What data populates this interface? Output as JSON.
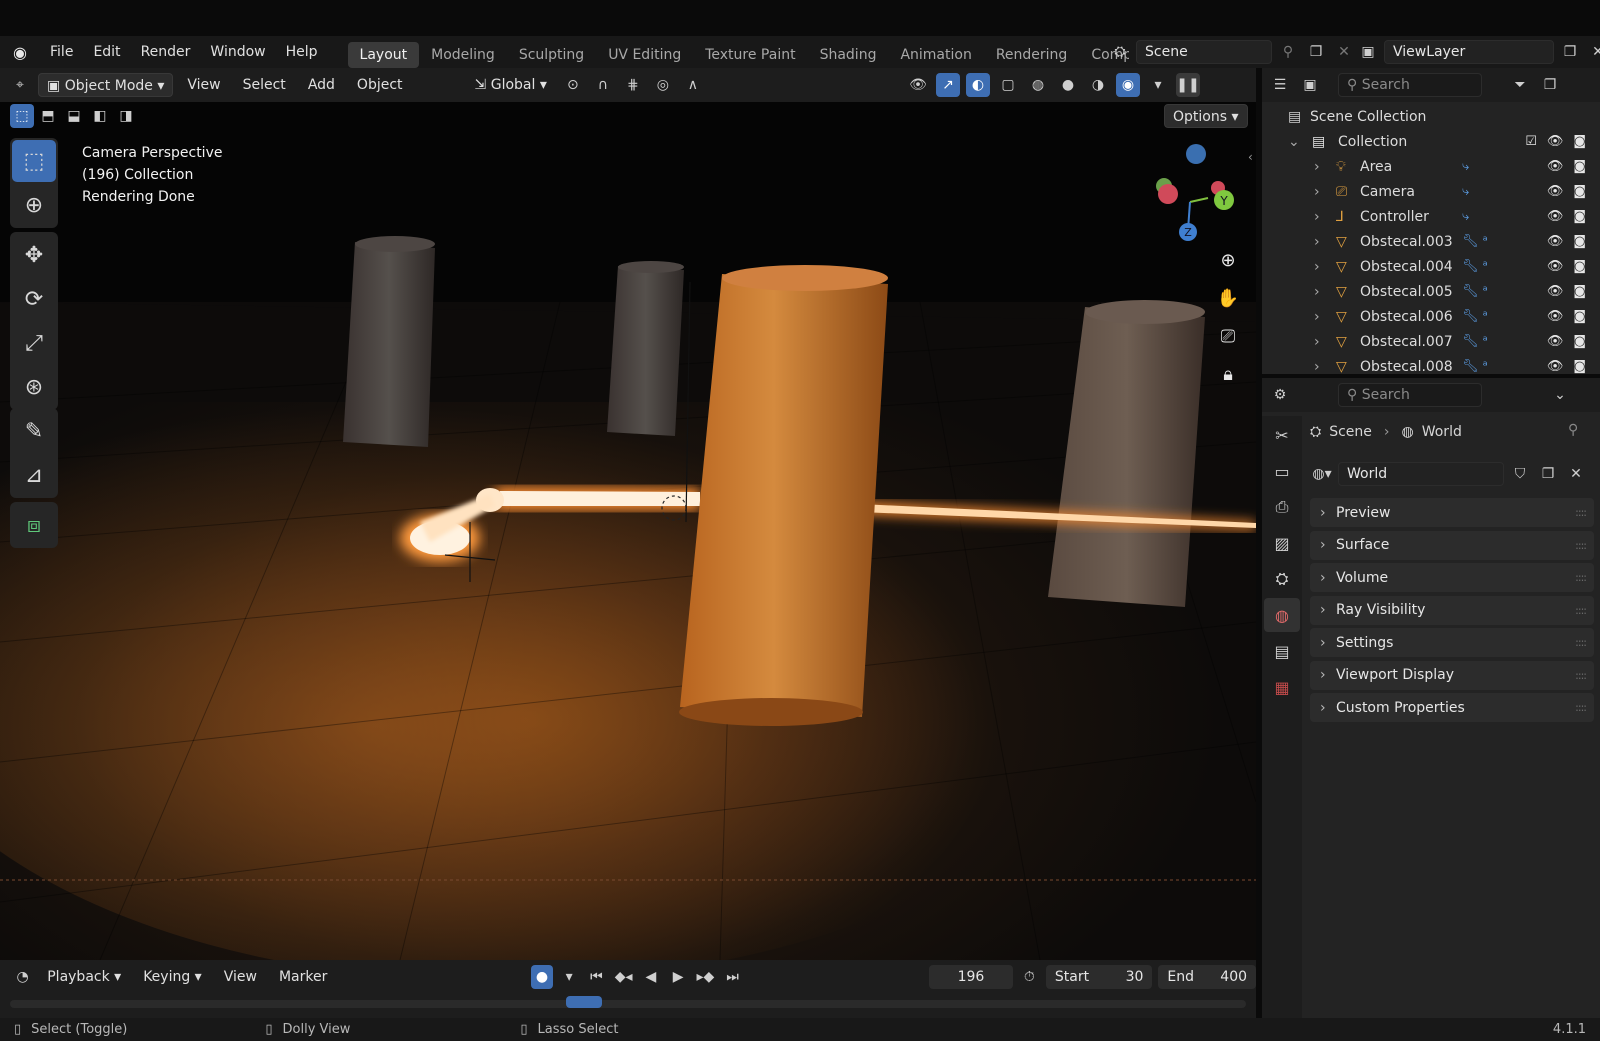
{
  "menu": [
    "File",
    "Edit",
    "Render",
    "Window",
    "Help"
  ],
  "workspaces": [
    {
      "label": "Layout",
      "active": true
    },
    {
      "label": "Modeling"
    },
    {
      "label": "Sculpting"
    },
    {
      "label": "UV Editing"
    },
    {
      "label": "Texture Paint"
    },
    {
      "label": "Shading"
    },
    {
      "label": "Animation"
    },
    {
      "label": "Rendering"
    },
    {
      "label": "Compo"
    }
  ],
  "scene_field": "Scene",
  "viewlayer_field": "ViewLayer",
  "viewport_header": {
    "mode": "Object Mode",
    "menus": [
      "View",
      "Select",
      "Add",
      "Object"
    ],
    "orientation": "Global",
    "options": "Options"
  },
  "viewport_overlay": {
    "line1": "Camera Perspective",
    "line2": "(196) Collection",
    "line3": "Rendering Done"
  },
  "gizmo": {
    "y": "Y",
    "z": "Z"
  },
  "outliner": {
    "search_placeholder": "Search",
    "scene_collection": "Scene Collection",
    "collection": "Collection",
    "items": [
      {
        "label": "Area",
        "icon": "light-icon"
      },
      {
        "label": "Camera",
        "icon": "camera-icon"
      },
      {
        "label": "Controller",
        "icon": "empty-icon"
      },
      {
        "label": "Obstecal.003",
        "icon": "mesh-icon"
      },
      {
        "label": "Obstecal.004",
        "icon": "mesh-icon"
      },
      {
        "label": "Obstecal.005",
        "icon": "mesh-icon"
      },
      {
        "label": "Obstecal.006",
        "icon": "mesh-icon"
      },
      {
        "label": "Obstecal.007",
        "icon": "mesh-icon"
      },
      {
        "label": "Obstecal.008",
        "icon": "mesh-icon"
      }
    ]
  },
  "properties": {
    "search_placeholder": "Search",
    "breadcrumb_scene": "Scene",
    "breadcrumb_world": "World",
    "world_name": "World",
    "panels": [
      "Preview",
      "Surface",
      "Volume",
      "Ray Visibility",
      "Settings",
      "Viewport Display",
      "Custom Properties"
    ]
  },
  "timeline": {
    "menus": [
      "Playback",
      "Keying",
      "View",
      "Marker"
    ],
    "current_frame": "196",
    "start_label": "Start",
    "start_value": "30",
    "end_label": "End",
    "end_value": "400"
  },
  "statusbar": {
    "hint1": "Select (Toggle)",
    "hint2": "Dolly View",
    "hint3": "Lasso Select",
    "version": "4.1.1"
  },
  "colors": {
    "accent": "#3e6eb3",
    "glow": "#ff9a3c",
    "pillar": "#c8762f"
  }
}
